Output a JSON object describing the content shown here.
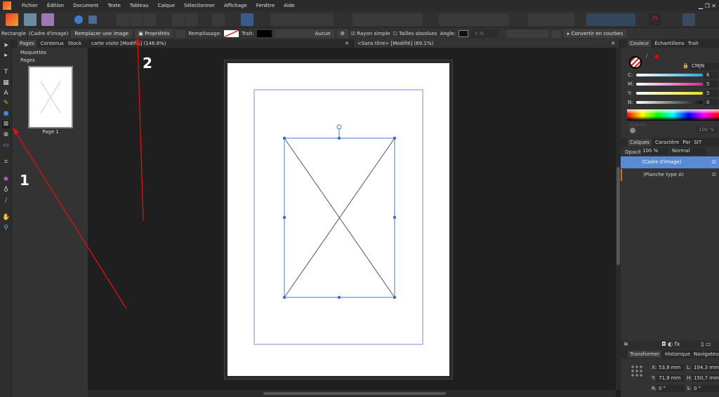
{
  "menu": [
    "Fichier",
    "Édition",
    "Document",
    "Texte",
    "Tableau",
    "Calque",
    "Sélectionner",
    "Affichage",
    "Fenêtre",
    "Aide"
  ],
  "context": {
    "object": "Rectangle",
    "type": "(Cadre d'image)",
    "replace": "Remplacer une image",
    "properties": "Propriétés",
    "fill_label": "Remplissage:",
    "stroke_label": "Trait:",
    "stroke_value": "Aucun",
    "radius": "Rayon simple",
    "absolute": "Tailles absolues",
    "angle_label": "Angle:",
    "angle_value": "0 %",
    "convert": "Convertir en courbes"
  },
  "doc_tabs": [
    {
      "label": "carte visite [Modifié] (146.8%)"
    },
    {
      "label": "<Sans titre> [Modifié] (69.1%)"
    }
  ],
  "pages_panel": {
    "tabs": [
      "Pages",
      "Contenus",
      "Stock"
    ],
    "sections": [
      "Maquettes",
      "Pages"
    ],
    "thumb_label": "Page 1"
  },
  "color_panel": {
    "tabs": [
      "Couleur",
      "Échantillons",
      "Trait"
    ],
    "model": "CMJN",
    "channels": [
      {
        "label": "C:",
        "value": "6",
        "color": "#2aa8d8"
      },
      {
        "label": "M:",
        "value": "5",
        "color": "#d8288c"
      },
      {
        "label": "Y:",
        "value": "5",
        "color": "#e8e020"
      },
      {
        "label": "N:",
        "value": "0",
        "color": "#666666"
      }
    ],
    "opacity_label": "Opacité",
    "opacity": "100 %"
  },
  "layers_panel": {
    "tabs": [
      "Calques",
      "Caractère",
      "Par",
      "SIT"
    ],
    "opacity_label": "Opacité:",
    "opacity": "100 %",
    "blend": "Normal",
    "layers": [
      "(Cadre d'image)",
      "(Planche type A)"
    ]
  },
  "transform_panel": {
    "tabs": [
      "Transformer",
      "Historique",
      "Navigateur"
    ],
    "x_label": "X:",
    "x": "53,8 mm",
    "y_label": "Y:",
    "y": "71,9 mm",
    "w_label": "L:",
    "w": "104,3 mm",
    "h_label": "H:",
    "h": "150,7 mm",
    "r_label": "R:",
    "r": "0 °",
    "s_label": "S:",
    "s": "0 °"
  },
  "annotations": {
    "one": "1",
    "two": "2"
  },
  "accent": "#5a8ad6"
}
